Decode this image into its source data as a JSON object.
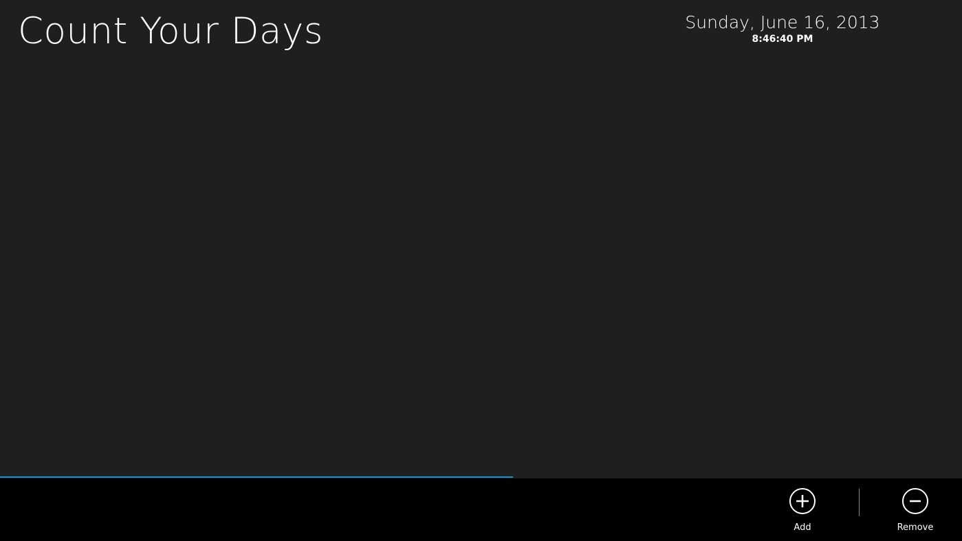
{
  "header": {
    "title": "Count Your Days",
    "date": "Sunday, June 16, 2013",
    "time": "8:46:40 PM"
  },
  "progress": {
    "fraction": 0.533,
    "color": "#1c8fcf"
  },
  "app_bar": {
    "add_label": "Add",
    "add_icon": "plus-circle-icon",
    "remove_label": "Remove",
    "remove_icon": "minus-circle-icon"
  },
  "colors": {
    "background": "#1f1f1f",
    "app_bar": "#000000",
    "text": "#ffffff"
  }
}
